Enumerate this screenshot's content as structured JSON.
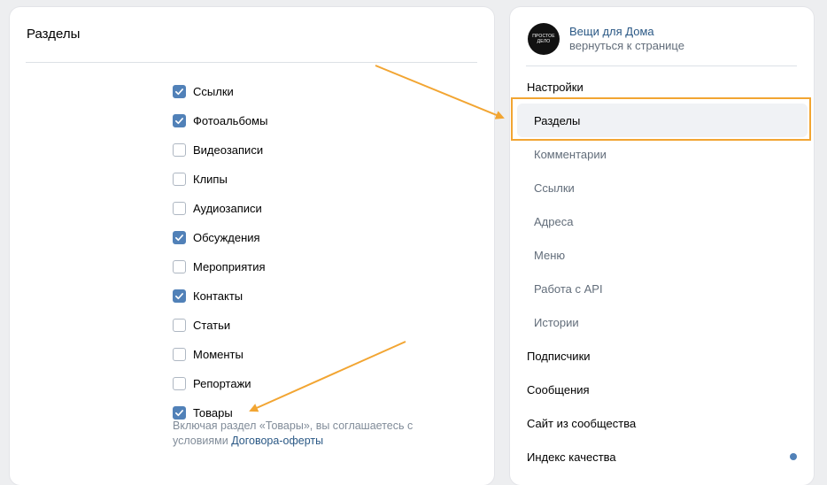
{
  "sections_panel": {
    "title": "Разделы",
    "items": [
      {
        "label": "Ссылки",
        "checked": true
      },
      {
        "label": "Фотоальбомы",
        "checked": true
      },
      {
        "label": "Видеозаписи",
        "checked": false
      },
      {
        "label": "Клипы",
        "checked": false
      },
      {
        "label": "Аудиозаписи",
        "checked": false
      },
      {
        "label": "Обсуждения",
        "checked": true
      },
      {
        "label": "Мероприятия",
        "checked": false
      },
      {
        "label": "Контакты",
        "checked": true
      },
      {
        "label": "Статьи",
        "checked": false
      },
      {
        "label": "Моменты",
        "checked": false
      },
      {
        "label": "Репортажи",
        "checked": false
      },
      {
        "label": "Товары",
        "checked": true
      }
    ],
    "note_text": "Включая раздел «Товары», вы соглашаетесь с условиями ",
    "note_link": "Договора-оферты"
  },
  "sidebar": {
    "group_name": "Вещи для Дома",
    "back_link": "вернуться к странице",
    "avatar_text": "ПРОСТОЕ ДЕЛО",
    "menu": [
      {
        "label": "Настройки",
        "level": "top"
      },
      {
        "label": "Разделы",
        "level": "sub",
        "active": true
      },
      {
        "label": "Комментарии",
        "level": "sub"
      },
      {
        "label": "Ссылки",
        "level": "sub"
      },
      {
        "label": "Адреса",
        "level": "sub"
      },
      {
        "label": "Меню",
        "level": "sub"
      },
      {
        "label": "Работа с API",
        "level": "sub"
      },
      {
        "label": "Истории",
        "level": "sub"
      },
      {
        "label": "Подписчики",
        "level": "top"
      },
      {
        "label": "Сообщения",
        "level": "top"
      },
      {
        "label": "Сайт из сообщества",
        "level": "top"
      },
      {
        "label": "Индекс качества",
        "level": "top",
        "dot": true
      }
    ]
  },
  "colors": {
    "accent": "#5181b8",
    "link": "#2a5885",
    "annotation": "#f2a532",
    "background": "#edeef0"
  }
}
